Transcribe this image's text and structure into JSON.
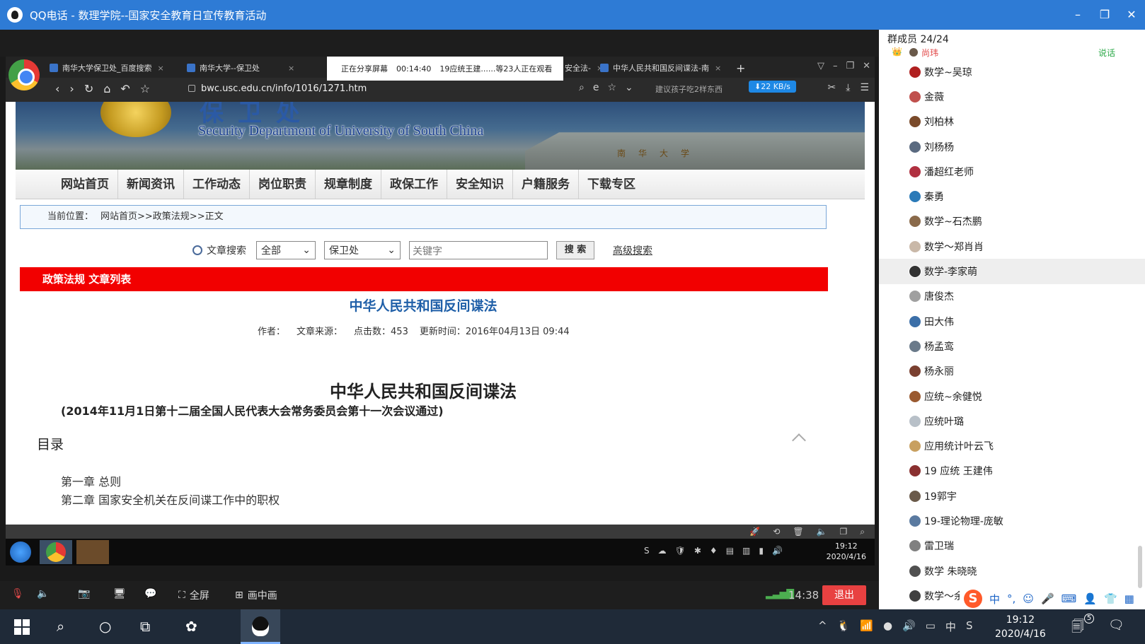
{
  "window": {
    "title": "QQ电话 - 数理学院--国家安全教育日宣传教育活动",
    "controls": {
      "min": "–",
      "restore": "❐",
      "close": "✕"
    }
  },
  "browser": {
    "tabs": [
      {
        "label": "南华大学保卫处_百度搜索",
        "close": "×"
      },
      {
        "label": "南华大学--保卫处",
        "close": "×"
      },
      {
        "label": "安全法-",
        "close": "×"
      },
      {
        "label": "中华人民共和国反间谍法-南",
        "close": "×"
      }
    ],
    "new_tab": "+",
    "sharing": {
      "status": "正在分享屏幕",
      "time": "00:14:40",
      "viewers": "19应统王建......等23人正在观看"
    },
    "tab_controls": {
      "shield": "▽",
      "min": "–",
      "restore": "❐",
      "close": "✕"
    },
    "nav": {
      "back": "‹",
      "forward": "›",
      "reload": "↻",
      "home": "⌂",
      "undo": "↶",
      "star": "☆"
    },
    "url": "bwc.usc.edu.cn/info/1016/1271.htm",
    "addr_icons": {
      "zoom": "⌕",
      "ie": "e",
      "fav": "☆",
      "down": "⌄"
    },
    "hint": "建议孩子吃2样东西",
    "speed": "⬇22 KB/s",
    "far_icons": {
      "cut": "✂",
      "download": "⤓",
      "menu": "☰"
    }
  },
  "site": {
    "banner_cn": "保卫处",
    "banner_en": "Security Department of University of South China",
    "banner_building_text": "南华大学",
    "nav": [
      "网站首页",
      "新闻资讯",
      "工作动态",
      "岗位职责",
      "规章制度",
      "政保工作",
      "安全知识",
      "户籍服务",
      "下载专区"
    ],
    "breadcrumb_label": "当前位置：",
    "breadcrumb": "网站首页>>政策法规>>正文",
    "search": {
      "label": "文章搜索",
      "scope": "全部",
      "dept": "保卫处",
      "keyword_placeholder": "关键字",
      "button": "搜 索",
      "advanced": "高级搜索",
      "arrow": "⌄"
    },
    "list_bar": "政策法规  文章列表",
    "article": {
      "link_title": "中华人民共和国反间谍法",
      "author": "作者：",
      "source": "文章来源：",
      "clicks": "点击数：453",
      "updated": "更新时间：2016年04月13日 09:44",
      "title": "中华人民共和国反间谍法",
      "subtitle": "(2014年11月1日第十二届全国人民代表大会常务委员会第十一次会议通过)",
      "toc_title": "目录",
      "toc_1": "第一章 总则",
      "toc_2": "第二章 国家安全机关在反间谍工作中的职权"
    }
  },
  "share_toolstrip": [
    "🚀",
    "⟲",
    "🗑",
    "🔈",
    "❐",
    "⌕"
  ],
  "share_taskbar": {
    "tray": [
      "S",
      "☁",
      "🛡",
      "✱",
      "♦",
      "▤",
      "▥",
      "▮",
      "🔊"
    ],
    "time": "19:12",
    "date": "2020/4/16"
  },
  "callbar": {
    "mic": "🎙",
    "speaker": "🔈",
    "camera": "📷",
    "screen": "🖥",
    "chat": "💬",
    "fullscreen_icon": "⛶",
    "fullscreen": "全屏",
    "pip_icon": "⊞",
    "pip": "画中画",
    "signal": "▂▃▅▇",
    "timer": "14:38",
    "exit": "退出"
  },
  "members": {
    "header": "群成员 24/24",
    "first": {
      "crown": "👑",
      "name": "尚玮",
      "talk": "说话"
    },
    "items": [
      {
        "name": "数学~吴琼",
        "color": "#b02020"
      },
      {
        "name": "金薇",
        "color": "#c0504d"
      },
      {
        "name": "刘柏林",
        "color": "#7a4a2a"
      },
      {
        "name": "刘杨杨",
        "color": "#5a6a80"
      },
      {
        "name": "潘超红老师",
        "color": "#b03040"
      },
      {
        "name": "秦勇",
        "color": "#2a7ab8"
      },
      {
        "name": "数学~石杰鹏",
        "color": "#8a6a4a"
      },
      {
        "name": "数学～郑肖肖",
        "color": "#c9b8a8"
      },
      {
        "name": "数学-李家萌",
        "color": "#333333"
      },
      {
        "name": "唐俊杰",
        "color": "#a0a0a0"
      },
      {
        "name": "田大伟",
        "color": "#3b6fa8"
      },
      {
        "name": "杨孟鸾",
        "color": "#6a7a8a"
      },
      {
        "name": "杨永丽",
        "color": "#7a4030"
      },
      {
        "name": "应统~余健悦",
        "color": "#9a5a30"
      },
      {
        "name": "应统叶璐",
        "color": "#b8c0c8"
      },
      {
        "name": "应用统计叶云飞",
        "color": "#c8a060"
      },
      {
        "name": "19 应统 王建伟",
        "color": "#8a3030"
      },
      {
        "name": "19郭宇",
        "color": "#6a5a4a"
      },
      {
        "name": "19-理论物理-庞敏",
        "color": "#5a7aa0"
      },
      {
        "name": "雷卫瑞",
        "color": "#808080"
      },
      {
        "name": "数学 朱晓晓",
        "color": "#505050"
      },
      {
        "name": "数学～余",
        "color": "#404040"
      }
    ],
    "selected_index": 8
  },
  "ime": {
    "logo": "S",
    "lang": "中",
    "punct": "°,",
    "emoji": "☺",
    "mic": "🎤",
    "keyboard": "⌨",
    "user": "👤",
    "shirt": "👕",
    "apps": "▦"
  },
  "taskbar": {
    "search": "⌕",
    "cortana": "○",
    "taskview": "⧉",
    "pinwheel": "✿",
    "tray": [
      "^",
      "🐧",
      "📶",
      "●",
      "🔊",
      "▭",
      "中",
      "S"
    ],
    "time": "19:12",
    "date": "2020/4/16",
    "notif": "🗐",
    "notif_count": "5",
    "chat": "🗨"
  }
}
